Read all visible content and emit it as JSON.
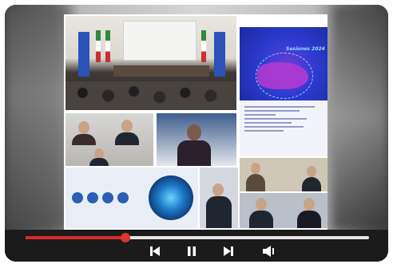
{
  "player": {
    "progress_fraction": 0.29,
    "colors": {
      "progress": "#d92a2a",
      "track": "#e6e6e6",
      "bar": "#1b1b1b",
      "icons": "#ffffff"
    },
    "controls": [
      {
        "name": "previous-button",
        "icon": "skip-previous-icon"
      },
      {
        "name": "pause-button",
        "icon": "pause-icon"
      },
      {
        "name": "next-button",
        "icon": "skip-next-icon"
      },
      {
        "name": "volume-button",
        "icon": "volume-icon"
      }
    ]
  },
  "video": {
    "poster_title": "Sesiones 2024"
  }
}
